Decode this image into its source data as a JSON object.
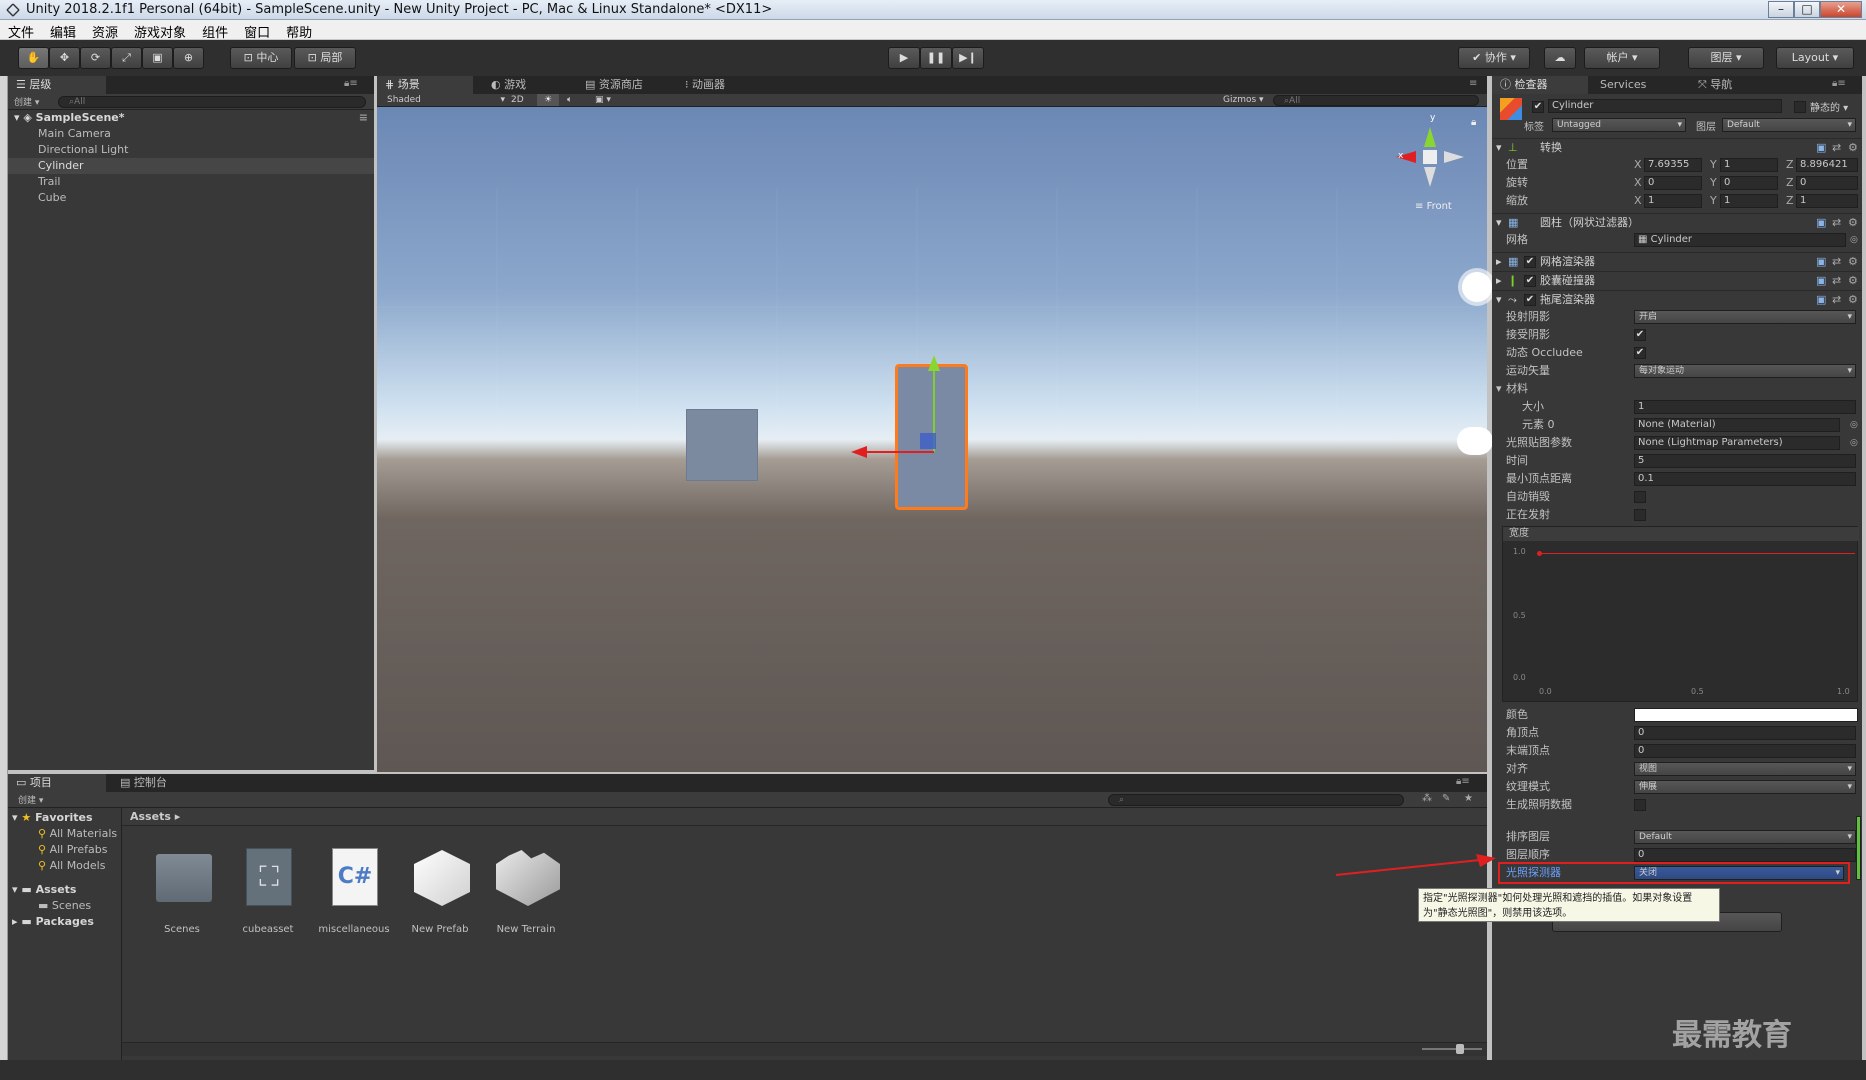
{
  "window": {
    "title": "Unity 2018.2.1f1 Personal (64bit) - SampleScene.unity - New Unity Project - PC, Mac & Linux Standalone* <DX11>"
  },
  "menu": [
    "文件",
    "编辑",
    "资源",
    "游戏对象",
    "组件",
    "窗口",
    "帮助"
  ],
  "toolbar": {
    "pivot": "中心",
    "space": "局部",
    "collab": "协作",
    "account": "帐户",
    "layers": "图层",
    "layout": "Layout"
  },
  "hierarchy": {
    "tab": "层级",
    "create": "创建",
    "search_placeholder": "All",
    "scene": "SampleScene*",
    "items": [
      "Main Camera",
      "Directional Light",
      "Cylinder",
      "Trail",
      "Cube"
    ],
    "selected_index": 2
  },
  "scene_view": {
    "tabs": [
      "场景",
      "游戏",
      "资源商店",
      "动画器"
    ],
    "shading": "Shaded",
    "mode_2d": "2D",
    "gizmos": "Gizmos",
    "search_placeholder": "All",
    "gizmo_y": "y",
    "gizmo_x": "x",
    "gizmo_label": "Front"
  },
  "inspector": {
    "tabs": [
      "检查器",
      "Services",
      "导航"
    ],
    "object_name": "Cylinder",
    "static_label": "静态的",
    "tag_label": "标签",
    "tag_value": "Untagged",
    "layer_label": "图层",
    "layer_value": "Default",
    "transform": {
      "title": "转换",
      "position_label": "位置",
      "rotation_label": "旋转",
      "scale_label": "缩放",
      "position": {
        "x": "7.69355",
        "y": "1",
        "z": "8.896421"
      },
      "rotation": {
        "x": "0",
        "y": "0",
        "z": "0"
      },
      "scale": {
        "x": "1",
        "y": "1",
        "z": "1"
      }
    },
    "mesh_filter": {
      "title": "圆柱（网状过滤器）",
      "mesh_label": "网格",
      "mesh_value": "Cylinder"
    },
    "mesh_renderer": {
      "title": "网格渲染器"
    },
    "capsule_collider": {
      "title": "胶囊碰撞器"
    },
    "trail_renderer": {
      "title": "拖尾渲染器",
      "cast_shadows_label": "投射阴影",
      "cast_shadows_value": "开启",
      "receive_shadows_label": "接受阴影",
      "dynamic_occludee_label": "动态 Occludee",
      "motion_vectors_label": "运动矢量",
      "motion_vectors_value": "每对象运动",
      "materials_label": "材料",
      "size_label": "大小",
      "size_value": "1",
      "element0_label": "元素 0",
      "element0_value": "None (Material)",
      "lightmap_params_label": "光照贴图参数",
      "lightmap_params_value": "None (Lightmap Parameters)",
      "time_label": "时间",
      "time_value": "5",
      "min_vertex_label": "最小顶点距离",
      "min_vertex_value": "0.1",
      "autodestruct_label": "自动销毁",
      "emitting_label": "正在发射",
      "width_label": "宽度",
      "curve_y_ticks": [
        "1.0",
        "0.5",
        "0.0"
      ],
      "curve_x_ticks": [
        "0.0",
        "0.5",
        "1.0"
      ],
      "color_label": "颜色",
      "corner_vertices_label": "角顶点",
      "corner_vertices_value": "0",
      "end_cap_label": "末端顶点",
      "end_cap_value": "0",
      "alignment_label": "对齐",
      "alignment_value": "视图",
      "texture_mode_label": "纹理模式",
      "texture_mode_value": "伸展",
      "gen_lighting_label": "生成照明数据",
      "sorting_layer_label": "排序图层",
      "sorting_layer_value": "Default",
      "order_label": "图层顺序",
      "order_value": "0",
      "light_probes_label": "光照探测器",
      "light_probes_value": "关闭"
    },
    "tooltip": "指定\"光照探测器\"如何处理光照和遮挡的插值。如果对象设置为\"静态光照图\"，则禁用该选项。"
  },
  "project": {
    "tabs": [
      "项目",
      "控制台"
    ],
    "create": "创建",
    "favorites_label": "Favorites",
    "favorites": [
      "All Materials",
      "All Prefabs",
      "All Models"
    ],
    "assets_label": "Assets",
    "assets_children": [
      "Scenes"
    ],
    "packages_label": "Packages",
    "breadcrumb": "Assets",
    "items": [
      "Scenes",
      "cubeasset",
      "miscellaneous",
      "New Prefab",
      "New Terrain"
    ]
  },
  "watermark": "最需教育",
  "colors": {
    "accent_red": "#e02020",
    "selection_orange": "#ff7a1a",
    "axis_green": "#7fd02a"
  }
}
